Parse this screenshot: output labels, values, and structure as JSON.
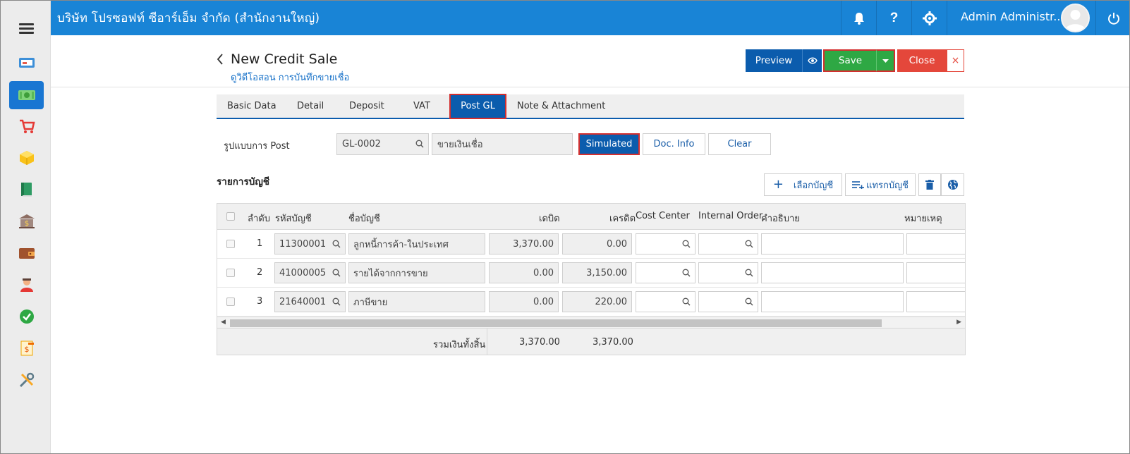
{
  "topbar": {
    "company": "บริษัท โปรซอฟท์ ซีอาร์เอ็ม จำกัด (สำนักงานใหญ่)",
    "user": "Admin Administr...",
    "bg_color": "#1984d6"
  },
  "sidebar": {
    "items": [
      {
        "icon": "dashboard-icon"
      },
      {
        "icon": "money-icon",
        "active": true
      },
      {
        "icon": "cart-icon"
      },
      {
        "icon": "box-icon"
      },
      {
        "icon": "book-icon"
      },
      {
        "icon": "bank-icon"
      },
      {
        "icon": "wallet-icon"
      },
      {
        "icon": "people-icon"
      },
      {
        "icon": "approve-icon"
      },
      {
        "icon": "report-icon"
      },
      {
        "icon": "tools-icon"
      }
    ]
  },
  "header": {
    "title": "New Credit Sale",
    "subtitle": "ดูวิดีโอสอน การบันทึกขายเชื่อ"
  },
  "actions": {
    "preview": "Preview",
    "save": "Save",
    "close": "Close",
    "close_x": "×"
  },
  "tabs": [
    {
      "label": "Basic Data"
    },
    {
      "label": "Detail"
    },
    {
      "label": "Deposit"
    },
    {
      "label": "VAT"
    },
    {
      "label": "Post GL",
      "active": true
    },
    {
      "label": "Note & Attachment"
    }
  ],
  "post_format": {
    "label": "รูปแบบการ Post",
    "code": "GL-0002",
    "name": "ขายเงินเชื่อ",
    "simulated": "Simulated",
    "doc_info": "Doc. Info",
    "clear": "Clear"
  },
  "accounts": {
    "title": "รายการบัญชี",
    "select_btn": "เลือกบัญชี",
    "insert_btn": "แทรกบัญชี",
    "columns": {
      "seq": "ลำดับ",
      "code": "รหัสบัญชี",
      "name": "ชื่อบัญชี",
      "debit": "เดบิต",
      "credit": "เครดิต",
      "cost_center": "Cost Center",
      "internal_order": "Internal Order",
      "description": "คำอธิบาย",
      "remark": "หมายเหตุ"
    },
    "rows": [
      {
        "seq": "1",
        "code": "11300001",
        "name": "ลูกหนี้การค้า-ในประเทศ",
        "debit": "3,370.00",
        "credit": "0.00"
      },
      {
        "seq": "2",
        "code": "41000005",
        "name": "รายได้จากการขาย",
        "debit": "0.00",
        "credit": "3,150.00"
      },
      {
        "seq": "3",
        "code": "21640001",
        "name": "ภาษีขาย",
        "debit": "0.00",
        "credit": "220.00"
      }
    ],
    "total_label": "รวมเงินทั้งสิ้น",
    "total_debit": "3,370.00",
    "total_credit": "3,370.00"
  }
}
